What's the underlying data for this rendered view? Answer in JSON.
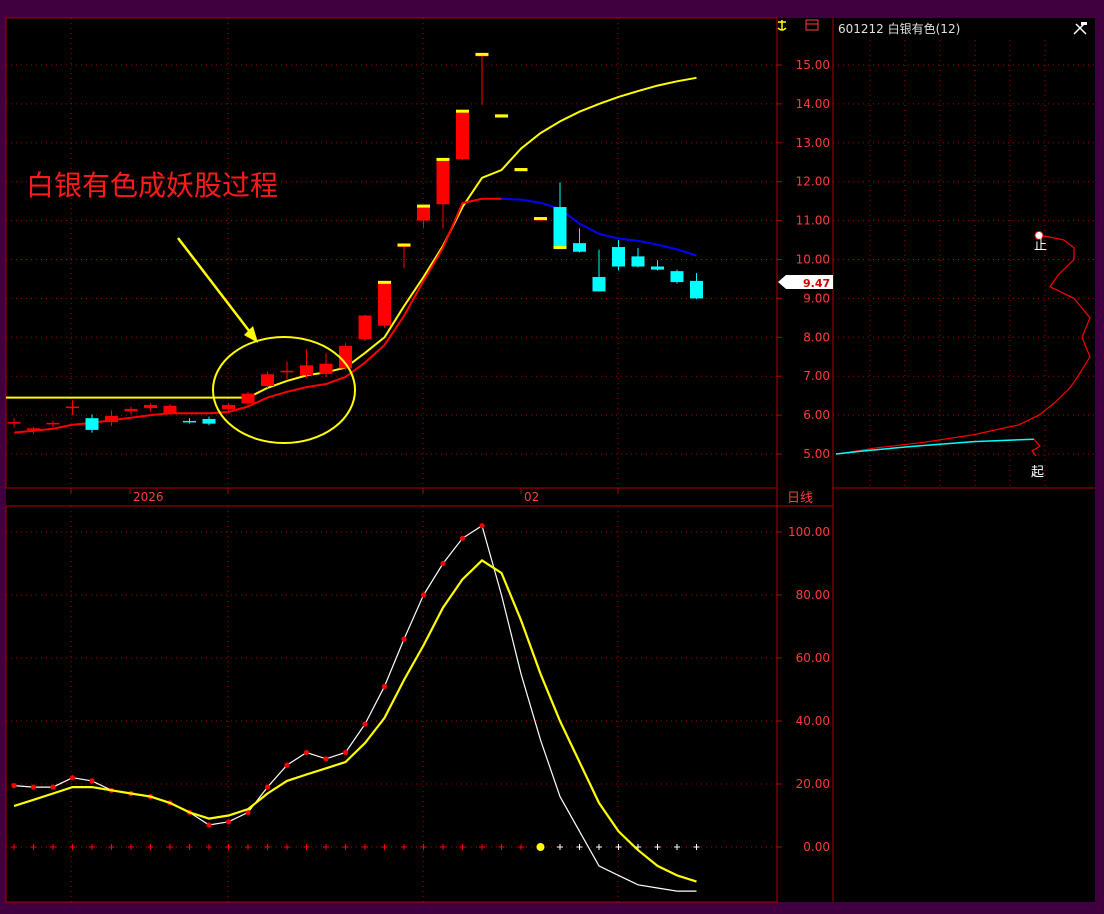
{
  "header": {
    "stock_label": "601212 白银有色(12)",
    "period_label": "日线",
    "anchor_icon": "anchor-icon",
    "tool_icon": "hammer-icon",
    "box_icon": "box-icon"
  },
  "annotation": {
    "text": "白银有色成妖股过程"
  },
  "colors": {
    "background": "#000000",
    "frame": "#400040",
    "grid": "#b00000",
    "axis_text": "#ff3b3b",
    "up": "#ff0000",
    "down": "#00ffff",
    "ma_yellow": "#ffff00",
    "ma_red": "#ff0000",
    "ma_blue": "#0000ff",
    "annotation": "#ff1a1a",
    "k_line": "#ffffff",
    "d_line": "#ffff00",
    "kdj_point": "#ff0000"
  },
  "chart_data": [
    {
      "type": "candlestick",
      "panel": "price",
      "x_labels": [
        "2026",
        "02"
      ],
      "ylim": [
        4.7,
        16.2
      ],
      "y_ticks": [
        5.0,
        6.0,
        7.0,
        8.0,
        9.0,
        10.0,
        11.0,
        12.0,
        13.0,
        14.0,
        15.0
      ],
      "y_tick_labels": [
        "5.00",
        "6.00",
        "7.00",
        "8.00",
        "9.00",
        "10.00",
        "11.00",
        "12.00",
        "13.00",
        "14.00",
        "15.00"
      ],
      "current_price_label": "9.47",
      "current_price": 9.47,
      "grid": true,
      "candles": [
        {
          "o": 5.8,
          "h": 5.92,
          "l": 5.68,
          "c": 5.82
        },
        {
          "o": 5.62,
          "h": 5.7,
          "l": 5.52,
          "c": 5.66
        },
        {
          "o": 5.78,
          "h": 5.86,
          "l": 5.7,
          "c": 5.8
        },
        {
          "o": 6.2,
          "h": 6.38,
          "l": 6.0,
          "c": 6.22
        },
        {
          "o": 5.92,
          "h": 6.02,
          "l": 5.55,
          "c": 5.62
        },
        {
          "o": 5.82,
          "h": 6.12,
          "l": 5.72,
          "c": 5.98
        },
        {
          "o": 6.1,
          "h": 6.22,
          "l": 6.02,
          "c": 6.16
        },
        {
          "o": 6.18,
          "h": 6.3,
          "l": 6.1,
          "c": 6.26
        },
        {
          "o": 6.05,
          "h": 6.28,
          "l": 6.0,
          "c": 6.24
        },
        {
          "o": 5.85,
          "h": 5.92,
          "l": 5.78,
          "c": 5.82
        },
        {
          "o": 5.9,
          "h": 5.96,
          "l": 5.74,
          "c": 5.78
        },
        {
          "o": 6.15,
          "h": 6.3,
          "l": 6.08,
          "c": 6.26
        },
        {
          "o": 6.3,
          "h": 6.6,
          "l": 6.25,
          "c": 6.55
        },
        {
          "o": 6.75,
          "h": 7.12,
          "l": 6.7,
          "c": 7.05
        },
        {
          "o": 7.1,
          "h": 7.38,
          "l": 6.92,
          "c": 7.14
        },
        {
          "o": 7.02,
          "h": 7.7,
          "l": 6.95,
          "c": 7.28
        },
        {
          "o": 7.06,
          "h": 7.6,
          "l": 6.98,
          "c": 7.32
        },
        {
          "o": 7.2,
          "h": 7.85,
          "l": 7.15,
          "c": 7.78
        },
        {
          "o": 7.95,
          "h": 8.58,
          "l": 7.9,
          "c": 8.56
        },
        {
          "o": 8.3,
          "h": 9.42,
          "l": 8.25,
          "c": 9.4
        },
        {
          "o": 10.32,
          "h": 10.38,
          "l": 9.78,
          "c": 10.36
        },
        {
          "o": 11.0,
          "h": 11.38,
          "l": 10.82,
          "c": 11.36
        },
        {
          "o": 11.42,
          "h": 12.6,
          "l": 10.8,
          "c": 12.56
        },
        {
          "o": 12.58,
          "h": 13.82,
          "l": 12.55,
          "c": 13.8
        },
        {
          "o": 15.25,
          "h": 15.28,
          "l": 13.98,
          "c": 15.26
        },
        {
          "o": 13.68,
          "h": 13.7,
          "l": 13.66,
          "c": 13.68
        },
        {
          "o": 12.3,
          "h": 12.34,
          "l": 12.26,
          "c": 12.3
        },
        {
          "o": 11.04,
          "h": 11.08,
          "l": 11.0,
          "c": 11.04
        },
        {
          "o": 11.35,
          "h": 11.98,
          "l": 10.32,
          "c": 10.32
        },
        {
          "o": 10.42,
          "h": 10.8,
          "l": 10.18,
          "c": 10.2
        },
        {
          "o": 9.55,
          "h": 10.25,
          "l": 9.18,
          "c": 9.18
        },
        {
          "o": 10.32,
          "h": 10.5,
          "l": 9.72,
          "c": 9.82
        },
        {
          "o": 10.08,
          "h": 10.3,
          "l": 9.8,
          "c": 9.82
        },
        {
          "o": 9.82,
          "h": 9.98,
          "l": 9.72,
          "c": 9.74
        },
        {
          "o": 9.7,
          "h": 9.74,
          "l": 9.38,
          "c": 9.42
        },
        {
          "o": 9.45,
          "h": 9.65,
          "l": 8.98,
          "c": 9.0
        }
      ],
      "ma_yellow": [
        [
          0,
          6.45
        ],
        [
          12,
          6.45
        ],
        [
          13,
          6.7
        ],
        [
          14,
          6.88
        ],
        [
          15,
          7.02
        ],
        [
          16,
          7.1
        ],
        [
          17,
          7.22
        ],
        [
          18,
          7.6
        ],
        [
          19,
          8.0
        ],
        [
          20,
          8.8
        ],
        [
          21,
          9.55
        ],
        [
          22,
          10.35
        ],
        [
          23,
          11.35
        ],
        [
          24,
          12.1
        ],
        [
          25,
          12.3
        ],
        [
          26,
          12.85
        ],
        [
          27,
          13.25
        ],
        [
          28,
          13.55
        ],
        [
          29,
          13.8
        ],
        [
          30,
          14.0
        ],
        [
          31,
          14.18
        ],
        [
          32,
          14.33
        ],
        [
          33,
          14.47
        ],
        [
          34,
          14.58
        ],
        [
          35,
          14.67
        ]
      ],
      "ma_red": [
        [
          0,
          5.55
        ],
        [
          1,
          5.6
        ],
        [
          2,
          5.65
        ],
        [
          3,
          5.75
        ],
        [
          4,
          5.8
        ],
        [
          5,
          5.87
        ],
        [
          6,
          5.93
        ],
        [
          7,
          6.0
        ],
        [
          8,
          6.05
        ],
        [
          9,
          6.05
        ],
        [
          10,
          6.05
        ],
        [
          11,
          6.08
        ],
        [
          12,
          6.22
        ],
        [
          13,
          6.45
        ],
        [
          14,
          6.6
        ],
        [
          15,
          6.72
        ],
        [
          16,
          6.8
        ],
        [
          17,
          6.98
        ],
        [
          18,
          7.35
        ],
        [
          19,
          7.8
        ],
        [
          20,
          8.55
        ],
        [
          21,
          9.45
        ],
        [
          22,
          10.3
        ],
        [
          23,
          11.45
        ],
        [
          24,
          11.56
        ],
        [
          25,
          11.56
        ]
      ],
      "ma_blue": [
        [
          25,
          11.56
        ],
        [
          26,
          11.54
        ],
        [
          27,
          11.46
        ],
        [
          28,
          11.3
        ],
        [
          29,
          10.92
        ],
        [
          30,
          10.66
        ],
        [
          31,
          10.54
        ],
        [
          32,
          10.48
        ],
        [
          33,
          10.38
        ],
        [
          34,
          10.26
        ],
        [
          35,
          10.1
        ]
      ],
      "chip_distribution": {
        "start_label": "起",
        "end_label": "止",
        "cyan_profile": [
          [
            5.0,
            2
          ],
          [
            5.08,
            30
          ],
          [
            5.2,
            80
          ],
          [
            5.32,
            140
          ],
          [
            5.38,
            200
          ]
        ],
        "red_profile": [
          [
            5.0,
            4
          ],
          [
            5.15,
            40
          ],
          [
            5.3,
            90
          ],
          [
            5.5,
            140
          ],
          [
            5.75,
            185
          ],
          [
            6.0,
            205
          ],
          [
            6.3,
            220
          ],
          [
            6.7,
            236
          ],
          [
            7.0,
            244
          ],
          [
            7.5,
            256
          ],
          [
            8.0,
            248
          ],
          [
            8.5,
            256
          ],
          [
            9.0,
            240
          ],
          [
            9.3,
            216
          ],
          [
            9.6,
            224
          ],
          [
            10.0,
            240
          ],
          [
            10.3,
            240
          ],
          [
            10.5,
            230
          ],
          [
            10.58,
            215
          ],
          [
            10.62,
            205
          ]
        ]
      }
    },
    {
      "type": "line",
      "panel": "kdj",
      "ylim": [
        -17,
        107
      ],
      "y_ticks": [
        0,
        20,
        40,
        60,
        80,
        100
      ],
      "y_tick_labels": [
        "0.00",
        "20.00",
        "40.00",
        "60.00",
        "80.00",
        "100.00"
      ],
      "grid": true,
      "series": [
        {
          "key": "k",
          "values": [
            [
              0,
              19.5
            ],
            [
              1,
              19
            ],
            [
              2,
              19
            ],
            [
              3,
              22
            ],
            [
              4,
              21
            ],
            [
              5,
              18
            ],
            [
              6,
              17
            ],
            [
              7,
              16
            ],
            [
              8,
              14
            ],
            [
              9,
              11
            ],
            [
              10,
              7
            ],
            [
              11,
              8
            ],
            [
              12,
              11
            ],
            [
              13,
              19
            ],
            [
              14,
              26
            ],
            [
              15,
              30
            ],
            [
              16,
              28
            ],
            [
              17,
              30
            ],
            [
              18,
              39
            ],
            [
              19,
              51
            ],
            [
              20,
              66
            ],
            [
              21,
              80
            ],
            [
              22,
              90
            ],
            [
              23,
              98
            ],
            [
              24,
              102
            ],
            [
              25,
              80
            ],
            [
              26,
              55
            ],
            [
              27,
              34
            ],
            [
              28,
              16
            ],
            [
              29,
              5
            ],
            [
              30,
              -6
            ],
            [
              31,
              -9
            ],
            [
              32,
              -12
            ],
            [
              33,
              -13
            ],
            [
              34,
              -14
            ],
            [
              35,
              -14
            ]
          ]
        },
        {
          "key": "d",
          "values": [
            [
              0,
              13
            ],
            [
              1,
              15
            ],
            [
              2,
              17
            ],
            [
              3,
              19
            ],
            [
              4,
              19
            ],
            [
              5,
              18
            ],
            [
              6,
              17
            ],
            [
              7,
              16
            ],
            [
              8,
              14
            ],
            [
              9,
              11
            ],
            [
              10,
              9
            ],
            [
              11,
              10
            ],
            [
              12,
              12
            ],
            [
              13,
              17
            ],
            [
              14,
              21
            ],
            [
              15,
              23
            ],
            [
              16,
              25
            ],
            [
              17,
              27
            ],
            [
              18,
              33
            ],
            [
              19,
              41
            ],
            [
              20,
              53
            ],
            [
              21,
              64
            ],
            [
              22,
              76
            ],
            [
              23,
              85
            ],
            [
              24,
              91
            ],
            [
              25,
              87
            ],
            [
              26,
              72
            ],
            [
              27,
              55
            ],
            [
              28,
              40
            ],
            [
              29,
              27
            ],
            [
              30,
              14
            ],
            [
              31,
              5
            ],
            [
              32,
              -1
            ],
            [
              33,
              -6
            ],
            [
              34,
              -9
            ],
            [
              35,
              -11
            ]
          ]
        }
      ],
      "marker_value": 0
    }
  ]
}
